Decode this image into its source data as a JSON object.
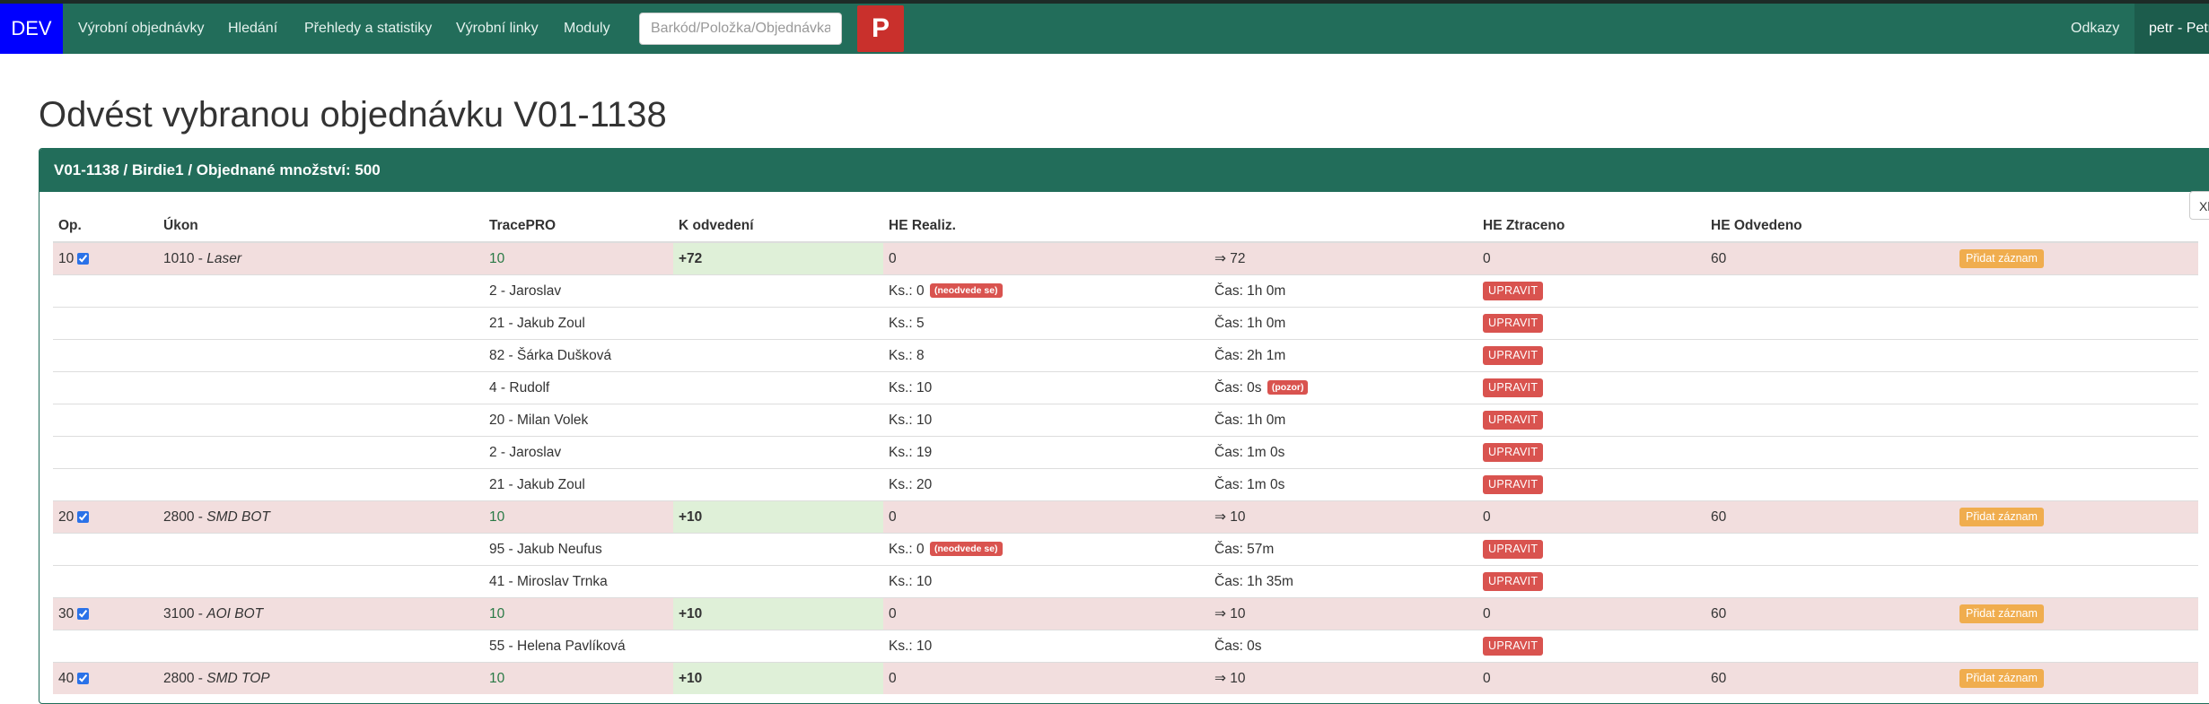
{
  "navbar": {
    "brand": "DEV",
    "items": [
      "Výrobní objednávky",
      "Hledání",
      "Přehledy a statistiky",
      "Výrobní linky",
      "Moduly"
    ],
    "search_placeholder": "Barkód/Položka/Objednávka/Plán",
    "p_button": "P",
    "links_label": "Odkazy",
    "user": "petr - Petr"
  },
  "page": {
    "title": "Odvést vybranou objednávku V01-1138"
  },
  "panel": {
    "heading": "V01-1138 / Birdie1 / Objednané množství: 500",
    "side_tag": "Xl"
  },
  "table": {
    "headers": [
      "Op.",
      "Úkon",
      "TracePRO",
      "K odvedení",
      "HE Realiz.",
      "",
      "HE Ztraceno",
      "HE Odvedeno",
      ""
    ],
    "add_label": "Přidat záznam",
    "edit_label": "UPRAVIT",
    "groups": [
      {
        "op": "10",
        "checked": true,
        "task_code": "1010",
        "task_name": "Laser",
        "tracepro": "10",
        "k_odvedeni": "+72",
        "he_realiz": "0",
        "arrow": "⇒ 72",
        "he_ztraceno": "0",
        "he_odvedeno": "60",
        "rows": [
          {
            "worker": "2 - Jaroslav",
            "ks": "Ks.: 0",
            "ks_badge": "(neodvede se)",
            "cas": "Čas: 1h 0m",
            "cas_badge": ""
          },
          {
            "worker": "21 - Jakub Zoul",
            "ks": "Ks.: 5",
            "ks_badge": "",
            "cas": "Čas: 1h 0m",
            "cas_badge": ""
          },
          {
            "worker": "82 - Šárka Dušková",
            "ks": "Ks.: 8",
            "ks_badge": "",
            "cas": "Čas: 2h 1m",
            "cas_badge": ""
          },
          {
            "worker": "4 - Rudolf",
            "ks": "Ks.: 10",
            "ks_badge": "",
            "cas": "Čas: 0s",
            "cas_badge": "(pozor)"
          },
          {
            "worker": "20 - Milan Volek",
            "ks": "Ks.: 10",
            "ks_badge": "",
            "cas": "Čas: 1h 0m",
            "cas_badge": ""
          },
          {
            "worker": "2 - Jaroslav",
            "ks": "Ks.: 19",
            "ks_badge": "",
            "cas": "Čas: 1m 0s",
            "cas_badge": ""
          },
          {
            "worker": "21 - Jakub Zoul",
            "ks": "Ks.: 20",
            "ks_badge": "",
            "cas": "Čas: 1m 0s",
            "cas_badge": ""
          }
        ]
      },
      {
        "op": "20",
        "checked": true,
        "task_code": "2800",
        "task_name": "SMD BOT",
        "tracepro": "10",
        "k_odvedeni": "+10",
        "he_realiz": "0",
        "arrow": "⇒ 10",
        "he_ztraceno": "0",
        "he_odvedeno": "60",
        "rows": [
          {
            "worker": "95 - Jakub Neufus",
            "ks": "Ks.: 0",
            "ks_badge": "(neodvede se)",
            "cas": "Čas: 57m",
            "cas_badge": ""
          },
          {
            "worker": "41 - Miroslav Trnka",
            "ks": "Ks.: 10",
            "ks_badge": "",
            "cas": "Čas: 1h 35m",
            "cas_badge": ""
          }
        ]
      },
      {
        "op": "30",
        "checked": true,
        "task_code": "3100",
        "task_name": "AOI BOT",
        "tracepro": "10",
        "k_odvedeni": "+10",
        "he_realiz": "0",
        "arrow": "⇒ 10",
        "he_ztraceno": "0",
        "he_odvedeno": "60",
        "rows": [
          {
            "worker": "55 - Helena Pavlíková",
            "ks": "Ks.: 10",
            "ks_badge": "",
            "cas": "Čas: 0s",
            "cas_badge": ""
          }
        ]
      },
      {
        "op": "40",
        "checked": true,
        "task_code": "2800",
        "task_name": "SMD TOP",
        "tracepro": "10",
        "k_odvedeni": "+10",
        "he_realiz": "0",
        "arrow": "⇒ 10",
        "he_ztraceno": "0",
        "he_odvedeno": "60",
        "rows": []
      }
    ]
  }
}
